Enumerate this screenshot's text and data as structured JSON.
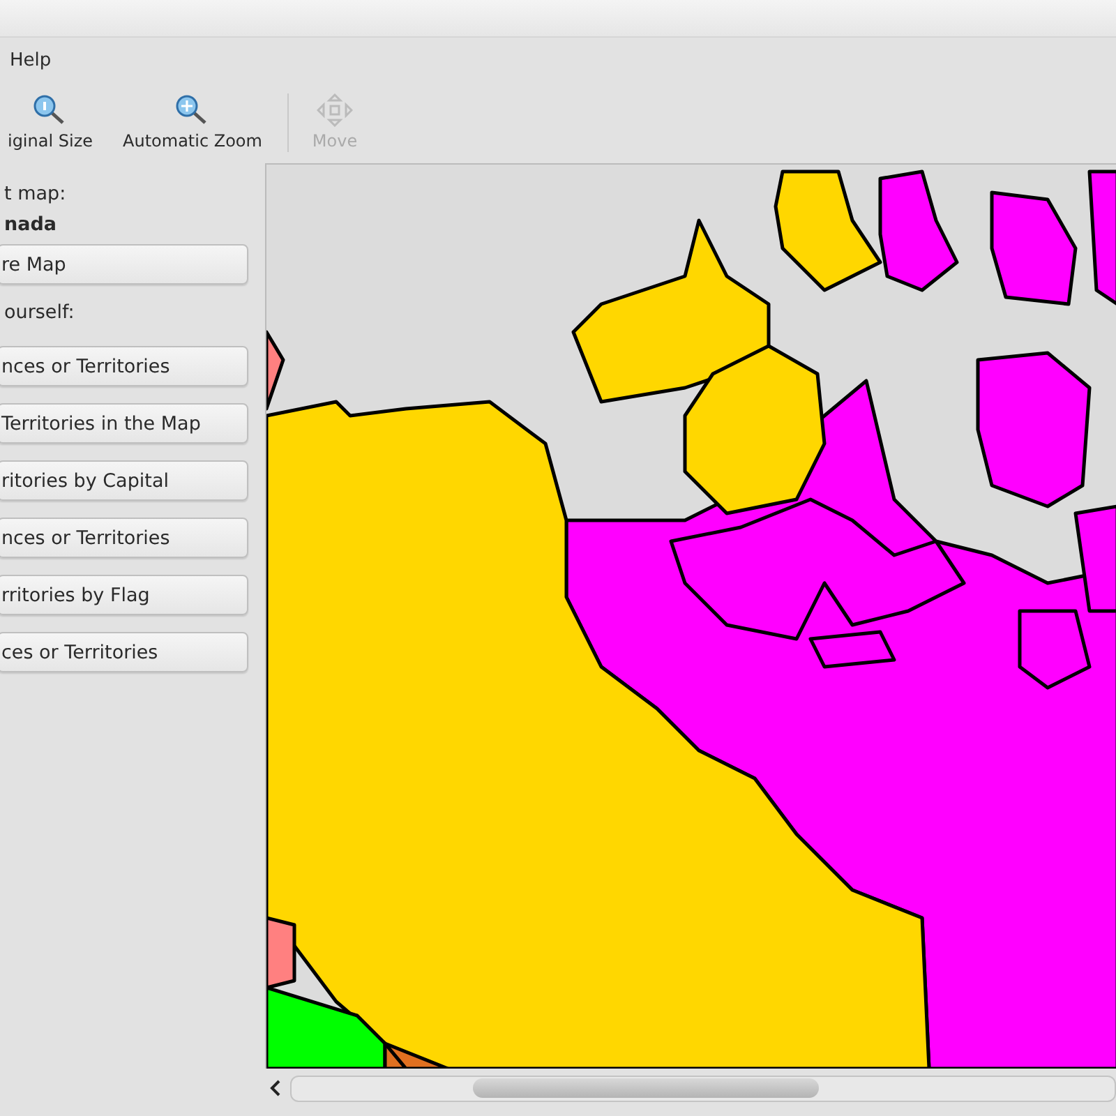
{
  "menu_bar": {
    "items": [
      "Help"
    ]
  },
  "toolbar": {
    "items": [
      {
        "label": "iginal Size",
        "kind": "zoom-original",
        "disabled": false
      },
      {
        "label": "Automatic Zoom",
        "kind": "zoom-fit",
        "disabled": false
      },
      {
        "label": "Move",
        "kind": "move",
        "disabled": true
      }
    ]
  },
  "sidebar": {
    "map_label": "t map:",
    "map_name": "nada",
    "map_button": "re Map",
    "section_label": "ourself:",
    "game_buttons": [
      "nces or Territories",
      "Territories in the Map",
      "ritories by Capital",
      "nces or Territories",
      "rritories by Flag",
      "ces or Territories"
    ]
  }
}
